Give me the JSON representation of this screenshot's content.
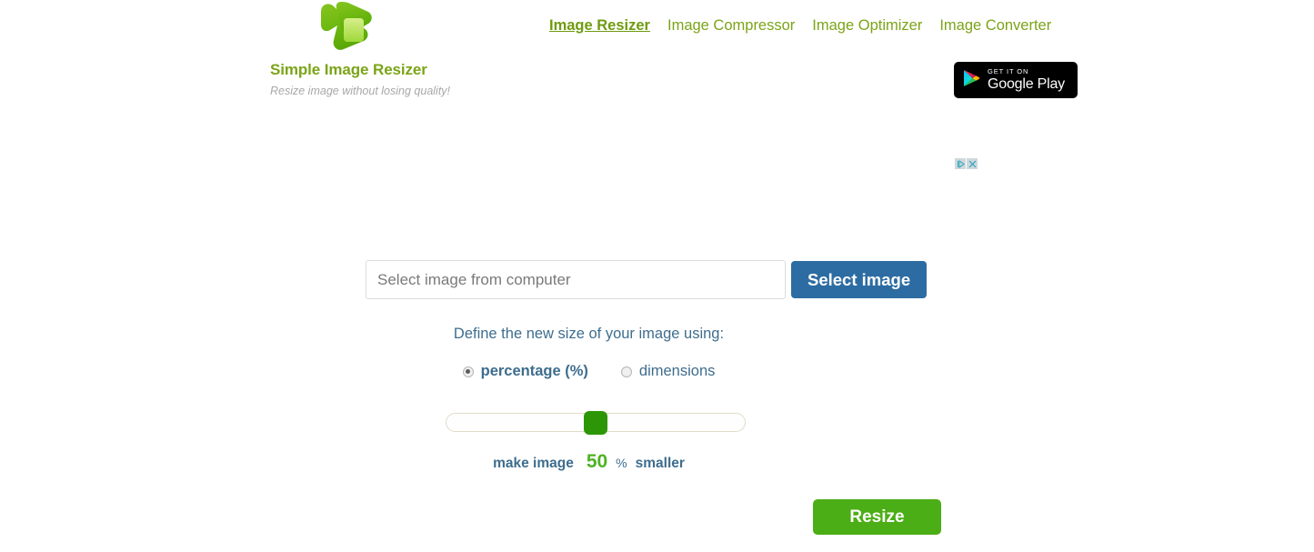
{
  "brand": {
    "logo_icon": "resizer-arrow-logo",
    "title": "Simple Image Resizer",
    "tagline": "Resize image without losing quality!",
    "title_color": "#7ba417"
  },
  "nav": {
    "items": [
      {
        "label": "Image Resizer",
        "active": true
      },
      {
        "label": "Image Compressor",
        "active": false
      },
      {
        "label": "Image Optimizer",
        "active": false
      },
      {
        "label": "Image Converter",
        "active": false
      }
    ],
    "link_color": "#7ba417"
  },
  "gplay": {
    "small_text": "GET IT ON",
    "big_text": "Google Play",
    "icon": "google-play-triangle-icon",
    "background": "#000000"
  },
  "adchoices": {
    "play_icon": "adchoices-play-icon",
    "close_icon": "adchoices-close-icon",
    "color": "#2aa5bd"
  },
  "form": {
    "file_placeholder": "Select image from computer",
    "file_value": "",
    "select_button_label": "Select image",
    "select_button_color": "#2d6ca2",
    "define_label": "Define the new size of your image using:",
    "options": [
      {
        "label": "percentage (%)",
        "selected": true
      },
      {
        "label": "dimensions",
        "selected": false
      }
    ],
    "slider": {
      "value": 50,
      "min": 0,
      "max": 100,
      "handle_color": "#2d9606"
    },
    "percent_prefix": "make image",
    "percent_value": "50",
    "percent_sign": "%",
    "percent_suffix": "smaller",
    "percent_value_color": "#4db324",
    "resize_button_label": "Resize",
    "resize_button_color": "#4cae16"
  }
}
